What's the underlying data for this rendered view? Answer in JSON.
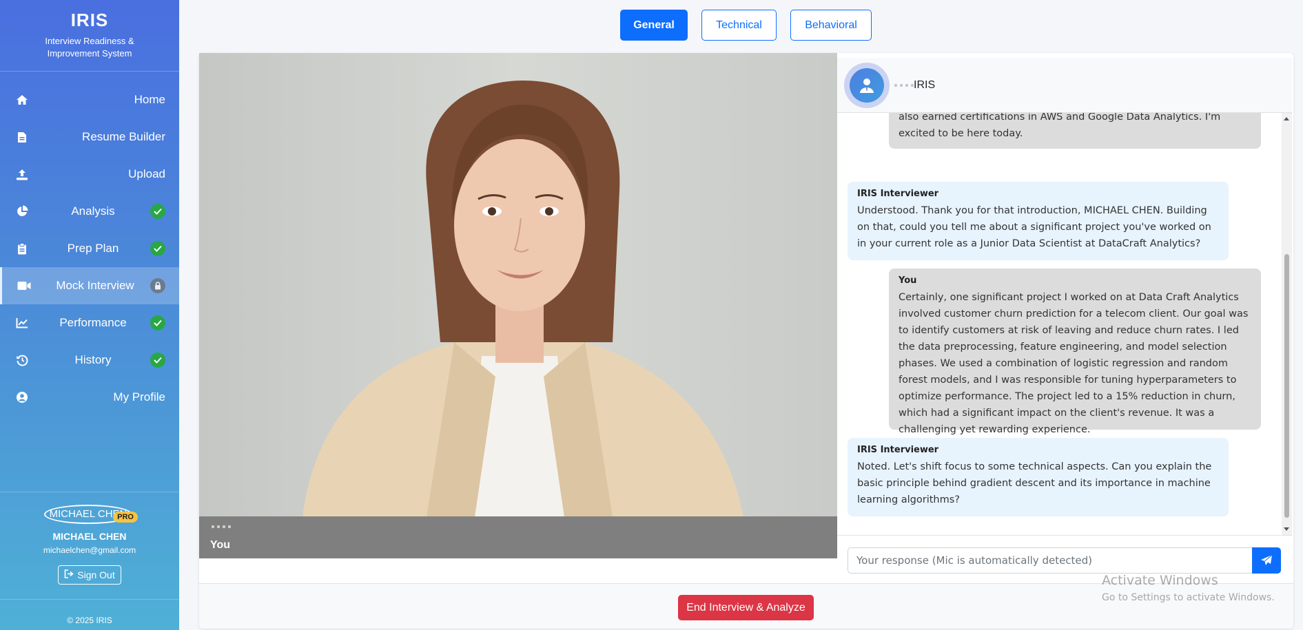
{
  "sidebar": {
    "brand_title": "IRIS",
    "brand_subtitle": "Interview Readiness & Improvement System",
    "items": [
      {
        "label": "Home",
        "icon": "home-icon",
        "status": null
      },
      {
        "label": "Resume Builder",
        "icon": "file-icon",
        "status": null
      },
      {
        "label": "Upload",
        "icon": "upload-icon",
        "status": null
      },
      {
        "label": "Analysis",
        "icon": "pie-chart-icon",
        "status": "complete"
      },
      {
        "label": "Prep Plan",
        "icon": "clipboard-icon",
        "status": "complete"
      },
      {
        "label": "Mock Interview",
        "icon": "video-icon",
        "status": "locked",
        "active": true
      },
      {
        "label": "Performance",
        "icon": "line-chart-icon",
        "status": "complete"
      },
      {
        "label": "History",
        "icon": "history-icon",
        "status": "complete"
      },
      {
        "label": "My Profile",
        "icon": "user-circle-icon",
        "status": null
      }
    ],
    "profile": {
      "avatar_text": "MICHAEL CHEN",
      "badge": "PRO",
      "name": "MICHAEL CHEN",
      "email": "michaelchen@gmail.com",
      "sign_out": "Sign Out"
    },
    "copyright": "© 2025 IRIS"
  },
  "tabs": [
    {
      "label": "General",
      "active": true
    },
    {
      "label": "Technical",
      "active": false
    },
    {
      "label": "Behavioral",
      "active": false
    }
  ],
  "video": {
    "label": "You"
  },
  "chat": {
    "title": "IRIS",
    "messages": [
      {
        "who": "",
        "type": "user",
        "text": "…SQL, and various machine learning and deep learning libraries. I've also earned certifications in AWS and Google Data Analytics. I'm excited to be here today."
      },
      {
        "who": "IRIS Interviewer",
        "type": "bot",
        "text": "Understood. Thank you for that introduction, MICHAEL CHEN. Building on that, could you tell me about a significant project you've worked on in your current role as a Junior Data Scientist at DataCraft Analytics?"
      },
      {
        "who": "You",
        "type": "user",
        "text": "Certainly, one significant project I worked on at Data Craft Analytics involved customer churn prediction for a telecom client. Our goal was to identify customers at risk of leaving and reduce churn rates. I led the data preprocessing, feature engineering, and model selection phases. We used a combination of logistic regression and random forest models, and I was responsible for tuning hyperparameters to optimize performance. The project led to a 15% reduction in churn, which had a significant impact on the client's revenue. It was a challenging yet rewarding experience."
      },
      {
        "who": "IRIS Interviewer",
        "type": "bot",
        "text": "Noted. Let's shift focus to some technical aspects. Can you explain the basic principle behind gradient descent and its importance in machine learning algorithms?"
      }
    ],
    "input_placeholder": "Your response (Mic is automatically detected)"
  },
  "actions": {
    "end_interview": "End Interview & Analyze"
  },
  "watermark": {
    "line1": "Activate Windows",
    "line2": "Go to Settings to activate Windows."
  },
  "colors": {
    "primary": "#0d6efd",
    "danger": "#dc3545",
    "success": "#28a745",
    "user_bubble": "#dcdcdc",
    "bot_bubble": "#e7f3fd"
  }
}
